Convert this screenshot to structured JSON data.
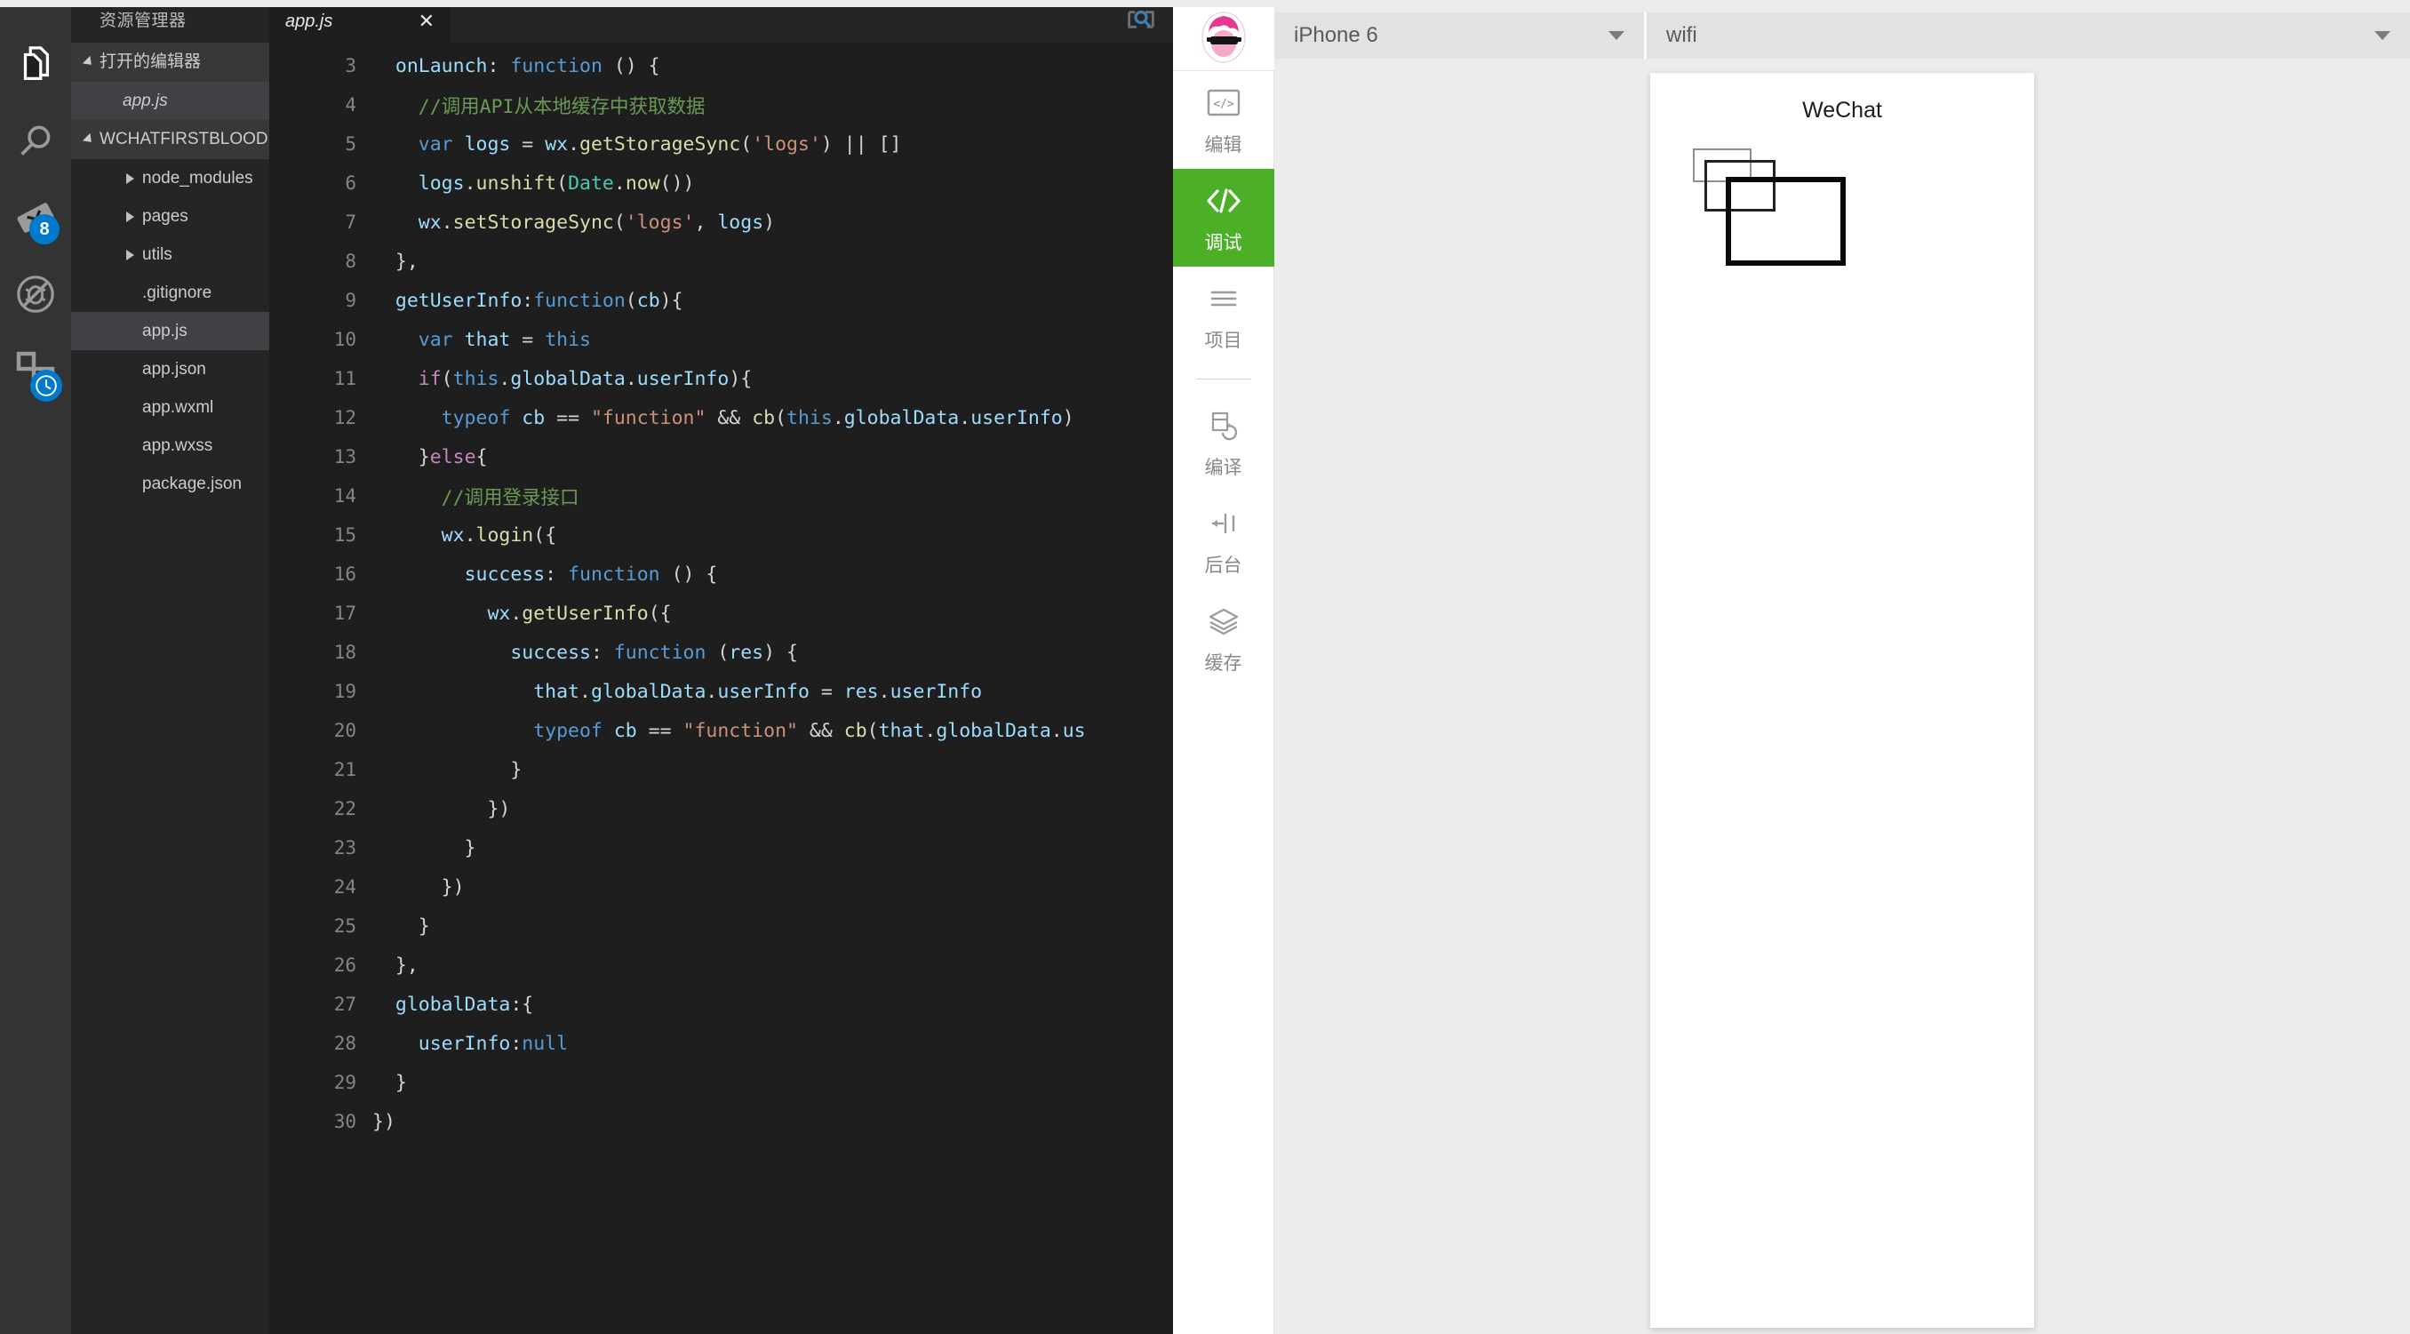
{
  "activitybar": {
    "items": [
      {
        "name": "explorer-icon",
        "label": "Explorer",
        "active": true
      },
      {
        "name": "search-icon",
        "label": "Search",
        "active": false
      },
      {
        "name": "source-control-icon",
        "label": "Source Control",
        "badge": "8"
      },
      {
        "name": "debug-disabled-icon",
        "label": "Debug (disabled)"
      },
      {
        "name": "extensions-icon",
        "label": "Extensions",
        "badge": "clock"
      }
    ]
  },
  "sidebar": {
    "title": "资源管理器",
    "sections": [
      {
        "label": "打开的编辑器"
      },
      {
        "label": "WCHATFIRSTBLOOD"
      }
    ],
    "open_editors": [
      {
        "label": "app.js",
        "selected": true
      }
    ],
    "tree": [
      {
        "label": "node_modules",
        "type": "folder",
        "selected": false
      },
      {
        "label": "pages",
        "type": "folder",
        "selected": false
      },
      {
        "label": "utils",
        "type": "folder",
        "selected": false
      },
      {
        "label": ".gitignore",
        "type": "file",
        "selected": false
      },
      {
        "label": "app.js",
        "type": "file",
        "selected": true
      },
      {
        "label": "app.json",
        "type": "file",
        "selected": false
      },
      {
        "label": "app.wxml",
        "type": "file",
        "selected": false
      },
      {
        "label": "app.wxss",
        "type": "file",
        "selected": false
      },
      {
        "label": "package.json",
        "type": "file",
        "selected": false
      }
    ]
  },
  "editor": {
    "tab": {
      "label": "app.js",
      "close_label": "✕"
    },
    "split_icon": "open-preview-icon",
    "first_line_number": 3,
    "lines": [
      {
        "n": 3,
        "tokens": [
          {
            "t": "def",
            "v": "  "
          },
          {
            "t": "prop",
            "v": "onLaunch"
          },
          {
            "t": "punc",
            "v": ": "
          },
          {
            "t": "kw",
            "v": "function"
          },
          {
            "t": "punc",
            "v": " () {"
          }
        ]
      },
      {
        "n": 4,
        "tokens": [
          {
            "t": "com",
            "v": "    //调用API从本地缓存中获取数据"
          }
        ]
      },
      {
        "n": 5,
        "tokens": [
          {
            "t": "def",
            "v": "    "
          },
          {
            "t": "kw",
            "v": "var"
          },
          {
            "t": "var",
            "v": " logs"
          },
          {
            "t": "punc",
            "v": " = "
          },
          {
            "t": "var",
            "v": "wx"
          },
          {
            "t": "punc",
            "v": "."
          },
          {
            "t": "fn",
            "v": "getStorageSync"
          },
          {
            "t": "punc",
            "v": "("
          },
          {
            "t": "str",
            "v": "'logs'"
          },
          {
            "t": "punc",
            "v": ") "
          },
          {
            "t": "punc",
            "v": "|| []"
          }
        ]
      },
      {
        "n": 6,
        "tokens": [
          {
            "t": "def",
            "v": "    "
          },
          {
            "t": "var",
            "v": "logs"
          },
          {
            "t": "punc",
            "v": "."
          },
          {
            "t": "fn",
            "v": "unshift"
          },
          {
            "t": "punc",
            "v": "("
          },
          {
            "t": "cls",
            "v": "Date"
          },
          {
            "t": "punc",
            "v": "."
          },
          {
            "t": "fn",
            "v": "now"
          },
          {
            "t": "punc",
            "v": "())"
          }
        ]
      },
      {
        "n": 7,
        "tokens": [
          {
            "t": "def",
            "v": "    "
          },
          {
            "t": "var",
            "v": "wx"
          },
          {
            "t": "punc",
            "v": "."
          },
          {
            "t": "fn",
            "v": "setStorageSync"
          },
          {
            "t": "punc",
            "v": "("
          },
          {
            "t": "str",
            "v": "'logs'"
          },
          {
            "t": "punc",
            "v": ", "
          },
          {
            "t": "var",
            "v": "logs"
          },
          {
            "t": "punc",
            "v": ")"
          }
        ]
      },
      {
        "n": 8,
        "tokens": [
          {
            "t": "punc",
            "v": "  },"
          }
        ]
      },
      {
        "n": 9,
        "tokens": [
          {
            "t": "def",
            "v": "  "
          },
          {
            "t": "prop",
            "v": "getUserInfo"
          },
          {
            "t": "punc",
            "v": ":"
          },
          {
            "t": "kw",
            "v": "function"
          },
          {
            "t": "punc",
            "v": "("
          },
          {
            "t": "var",
            "v": "cb"
          },
          {
            "t": "punc",
            "v": "){"
          }
        ]
      },
      {
        "n": 10,
        "tokens": [
          {
            "t": "def",
            "v": "    "
          },
          {
            "t": "kw",
            "v": "var"
          },
          {
            "t": "var",
            "v": " that"
          },
          {
            "t": "punc",
            "v": " = "
          },
          {
            "t": "kw",
            "v": "this"
          }
        ]
      },
      {
        "n": 11,
        "tokens": [
          {
            "t": "def",
            "v": "    "
          },
          {
            "t": "ctrl",
            "v": "if"
          },
          {
            "t": "punc",
            "v": "("
          },
          {
            "t": "kw",
            "v": "this"
          },
          {
            "t": "punc",
            "v": "."
          },
          {
            "t": "var",
            "v": "globalData"
          },
          {
            "t": "punc",
            "v": "."
          },
          {
            "t": "var",
            "v": "userInfo"
          },
          {
            "t": "punc",
            "v": "){"
          }
        ]
      },
      {
        "n": 12,
        "tokens": [
          {
            "t": "def",
            "v": "      "
          },
          {
            "t": "kw",
            "v": "typeof"
          },
          {
            "t": "var",
            "v": " cb"
          },
          {
            "t": "punc",
            "v": " == "
          },
          {
            "t": "str",
            "v": "\"function\""
          },
          {
            "t": "punc",
            "v": " && "
          },
          {
            "t": "fn",
            "v": "cb"
          },
          {
            "t": "punc",
            "v": "("
          },
          {
            "t": "kw",
            "v": "this"
          },
          {
            "t": "punc",
            "v": "."
          },
          {
            "t": "var",
            "v": "globalData"
          },
          {
            "t": "punc",
            "v": "."
          },
          {
            "t": "var",
            "v": "userInfo"
          },
          {
            "t": "punc",
            "v": ")"
          }
        ]
      },
      {
        "n": 13,
        "tokens": [
          {
            "t": "punc",
            "v": "    }"
          },
          {
            "t": "ctrl",
            "v": "else"
          },
          {
            "t": "punc",
            "v": "{"
          }
        ]
      },
      {
        "n": 14,
        "tokens": [
          {
            "t": "com",
            "v": "      //调用登录接口"
          }
        ]
      },
      {
        "n": 15,
        "tokens": [
          {
            "t": "def",
            "v": "      "
          },
          {
            "t": "var",
            "v": "wx"
          },
          {
            "t": "punc",
            "v": "."
          },
          {
            "t": "fn",
            "v": "login"
          },
          {
            "t": "punc",
            "v": "({"
          }
        ]
      },
      {
        "n": 16,
        "tokens": [
          {
            "t": "def",
            "v": "        "
          },
          {
            "t": "prop",
            "v": "success"
          },
          {
            "t": "punc",
            "v": ": "
          },
          {
            "t": "kw",
            "v": "function"
          },
          {
            "t": "punc",
            "v": " () {"
          }
        ]
      },
      {
        "n": 17,
        "tokens": [
          {
            "t": "def",
            "v": "          "
          },
          {
            "t": "var",
            "v": "wx"
          },
          {
            "t": "punc",
            "v": "."
          },
          {
            "t": "fn",
            "v": "getUserInfo"
          },
          {
            "t": "punc",
            "v": "({"
          }
        ]
      },
      {
        "n": 18,
        "tokens": [
          {
            "t": "def",
            "v": "            "
          },
          {
            "t": "prop",
            "v": "success"
          },
          {
            "t": "punc",
            "v": ": "
          },
          {
            "t": "kw",
            "v": "function"
          },
          {
            "t": "punc",
            "v": " ("
          },
          {
            "t": "var",
            "v": "res"
          },
          {
            "t": "punc",
            "v": ") {"
          }
        ]
      },
      {
        "n": 19,
        "tokens": [
          {
            "t": "def",
            "v": "              "
          },
          {
            "t": "var",
            "v": "that"
          },
          {
            "t": "punc",
            "v": "."
          },
          {
            "t": "var",
            "v": "globalData"
          },
          {
            "t": "punc",
            "v": "."
          },
          {
            "t": "var",
            "v": "userInfo"
          },
          {
            "t": "punc",
            "v": " = "
          },
          {
            "t": "var",
            "v": "res"
          },
          {
            "t": "punc",
            "v": "."
          },
          {
            "t": "var",
            "v": "userInfo"
          }
        ]
      },
      {
        "n": 20,
        "tokens": [
          {
            "t": "def",
            "v": "              "
          },
          {
            "t": "kw",
            "v": "typeof"
          },
          {
            "t": "var",
            "v": " cb"
          },
          {
            "t": "punc",
            "v": " == "
          },
          {
            "t": "str",
            "v": "\"function\""
          },
          {
            "t": "punc",
            "v": " && "
          },
          {
            "t": "fn",
            "v": "cb"
          },
          {
            "t": "punc",
            "v": "("
          },
          {
            "t": "var",
            "v": "that"
          },
          {
            "t": "punc",
            "v": "."
          },
          {
            "t": "var",
            "v": "globalData"
          },
          {
            "t": "punc",
            "v": "."
          },
          {
            "t": "var",
            "v": "us"
          }
        ]
      },
      {
        "n": 21,
        "tokens": [
          {
            "t": "punc",
            "v": "            }"
          }
        ]
      },
      {
        "n": 22,
        "tokens": [
          {
            "t": "punc",
            "v": "          })"
          }
        ]
      },
      {
        "n": 23,
        "tokens": [
          {
            "t": "punc",
            "v": "        }"
          }
        ]
      },
      {
        "n": 24,
        "tokens": [
          {
            "t": "punc",
            "v": "      })"
          }
        ]
      },
      {
        "n": 25,
        "tokens": [
          {
            "t": "punc",
            "v": "    }"
          }
        ]
      },
      {
        "n": 26,
        "tokens": [
          {
            "t": "punc",
            "v": "  },"
          }
        ]
      },
      {
        "n": 27,
        "tokens": [
          {
            "t": "def",
            "v": "  "
          },
          {
            "t": "prop",
            "v": "globalData"
          },
          {
            "t": "punc",
            "v": ":{"
          }
        ]
      },
      {
        "n": 28,
        "tokens": [
          {
            "t": "def",
            "v": "    "
          },
          {
            "t": "prop",
            "v": "userInfo"
          },
          {
            "t": "punc",
            "v": ":"
          },
          {
            "t": "kw",
            "v": "null"
          }
        ]
      },
      {
        "n": 29,
        "tokens": [
          {
            "t": "punc",
            "v": "  }"
          }
        ]
      },
      {
        "n": 30,
        "tokens": [
          {
            "t": "punc",
            "v": "})"
          }
        ]
      }
    ]
  },
  "simulator": {
    "avatar_name": "user-avatar",
    "device_select": {
      "value": "iPhone 6"
    },
    "network_select": {
      "value": "wifi"
    },
    "phone": {
      "title": "WeChat"
    },
    "toolbar_items": [
      {
        "label": "编辑",
        "icon": "code-box-icon",
        "active": false
      },
      {
        "label": "调试",
        "icon": "code-brackets-icon",
        "active": true
      },
      {
        "label": "项目",
        "icon": "list-lines-icon",
        "active": false
      },
      {
        "label": "编译",
        "icon": "compile-refresh-icon",
        "active": false
      },
      {
        "label": "后台",
        "icon": "background-arrow-icon",
        "active": false
      },
      {
        "label": "缓存",
        "icon": "layers-icon",
        "active": false
      }
    ]
  },
  "colors": {
    "accent_green": "#4caf28",
    "badge_blue": "#007acc",
    "activitybar_bg": "#333333",
    "sidebar_bg": "#252526",
    "editor_bg": "#1e1e1e",
    "panel_bg": "#ececec"
  }
}
